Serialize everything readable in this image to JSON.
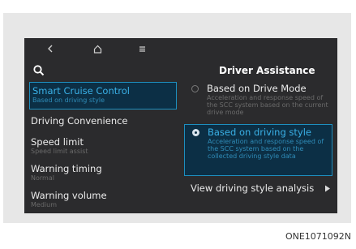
{
  "topbar": {
    "back_icon": "chevron-left-icon",
    "home_icon": "home-icon",
    "menu_icon": "menu-icon",
    "search_icon": "search-icon"
  },
  "panel": {
    "title": "Driver Assistance"
  },
  "menu": [
    {
      "label": "Smart Cruise Control",
      "sub": "Based on driving style",
      "selected": true
    },
    {
      "label": "Driving Convenience",
      "sub": ""
    },
    {
      "label": "Speed limit",
      "sub": "Speed limit assist"
    },
    {
      "label": "Warning timing",
      "sub": "Normal"
    },
    {
      "label": "Warning volume",
      "sub": "Medium"
    }
  ],
  "options": [
    {
      "title": "Based on Drive Mode",
      "desc": "Acceleration and response speed of the SCC system based on the current drive mode",
      "selected": false
    },
    {
      "title": "Based on driving style",
      "desc": "Acceleration and response speed of the SCC system based on the collected driving style data",
      "selected": true
    }
  ],
  "analysis_link": "View driving style analysis",
  "figure_code": "ONE1071092N",
  "colors": {
    "screen_bg": "#2b2b2d",
    "accent": "#1d8fbf",
    "accent_text": "#3ab0e6",
    "selected_bg": "#0c2f45",
    "frame_bg": "#e7e7e7"
  }
}
